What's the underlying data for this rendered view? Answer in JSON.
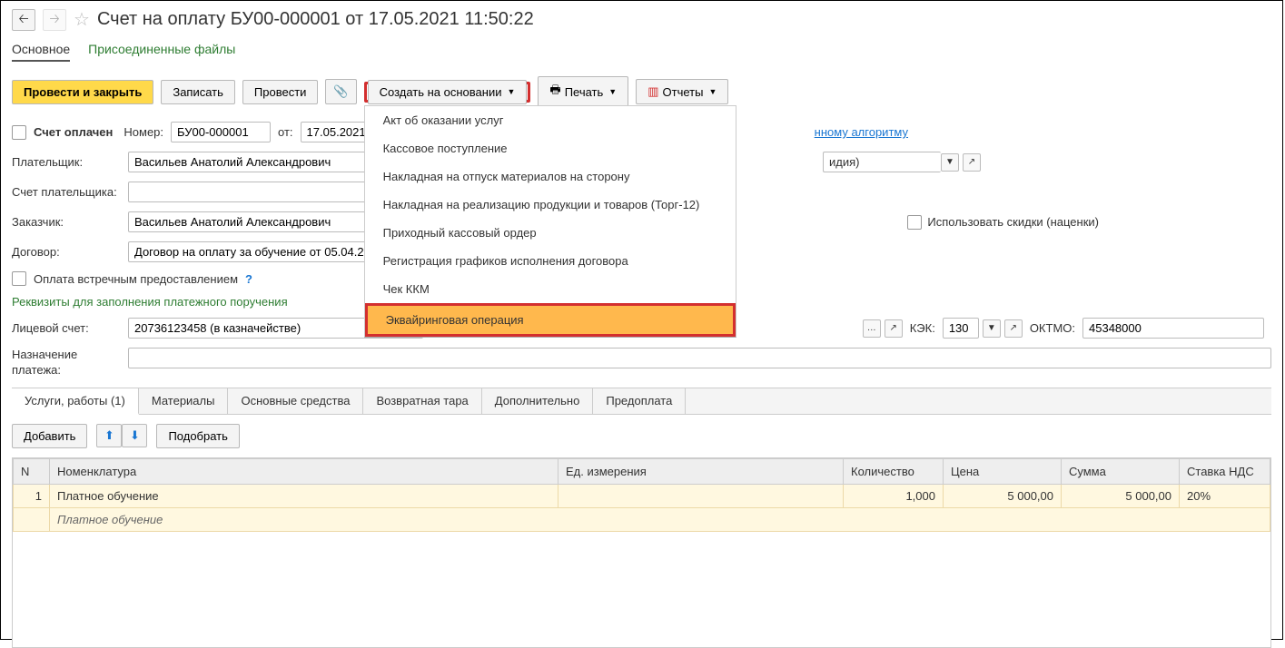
{
  "title": "Счет на оплату БУ00-000001 от 17.05.2021 11:50:22",
  "subnav": {
    "main": "Основное",
    "attached": "Присоединенные файлы"
  },
  "toolbar": {
    "post_close": "Провести и закрыть",
    "save": "Записать",
    "post": "Провести",
    "create_based": "Создать на основании",
    "print": "Печать",
    "reports": "Отчеты"
  },
  "dropdown": {
    "items": [
      "Акт об оказании услуг",
      "Кассовое поступление",
      "Накладная на отпуск материалов на сторону",
      "Накладная на реализацию продукции и товаров (Торг-12)",
      "Приходный кассовый ордер",
      "Регистрация графиков исполнения договора",
      "Чек ККМ",
      "Эквайринговая операция"
    ]
  },
  "form": {
    "paid_label": "Счет оплачен",
    "number_label": "Номер:",
    "number": "БУ00-000001",
    "from_label": "от:",
    "date": "17.05.2021 11:50",
    "algo_link_suffix": "нному алгоритму",
    "payer_label": "Плательщик:",
    "payer": "Васильев Анатолий Александрович",
    "payer_suffix": "идия)",
    "payer_account_label": "Счет плательщика:",
    "customer_label": "Заказчик:",
    "customer": "Васильев Анатолий Александрович",
    "discounts_label": "Использовать скидки (наценки)",
    "contract_label": "Договор:",
    "contract": "Договор на оплату за обучение от 05.04.2021 №",
    "counter_payment_label": "Оплата встречным предоставлением",
    "requisites_link": "Реквизиты для заполнения платежного поручения",
    "personal_acc_label": "Лицевой счет:",
    "personal_acc": "20736123458 (в казначействе)",
    "kek_label": "КЭК:",
    "kek": "130",
    "oktmo_label": "ОКТМО:",
    "oktmo": "45348000",
    "purpose_label": "Назначение платежа:"
  },
  "tabs": [
    "Услуги, работы (1)",
    "Материалы",
    "Основные средства",
    "Возвратная тара",
    "Дополнительно",
    "Предоплата"
  ],
  "tab_toolbar": {
    "add": "Добавить",
    "select": "Подобрать"
  },
  "table": {
    "headers": [
      "N",
      "Номенклатура",
      "Ед. измерения",
      "Количество",
      "Цена",
      "Сумма",
      "Ставка НДС"
    ],
    "rows": [
      {
        "n": "1",
        "name": "Платное обучение",
        "unit": "",
        "qty": "1,000",
        "price": "5 000,00",
        "sum": "5 000,00",
        "vat": "20%",
        "desc": "Платное обучение"
      }
    ]
  }
}
